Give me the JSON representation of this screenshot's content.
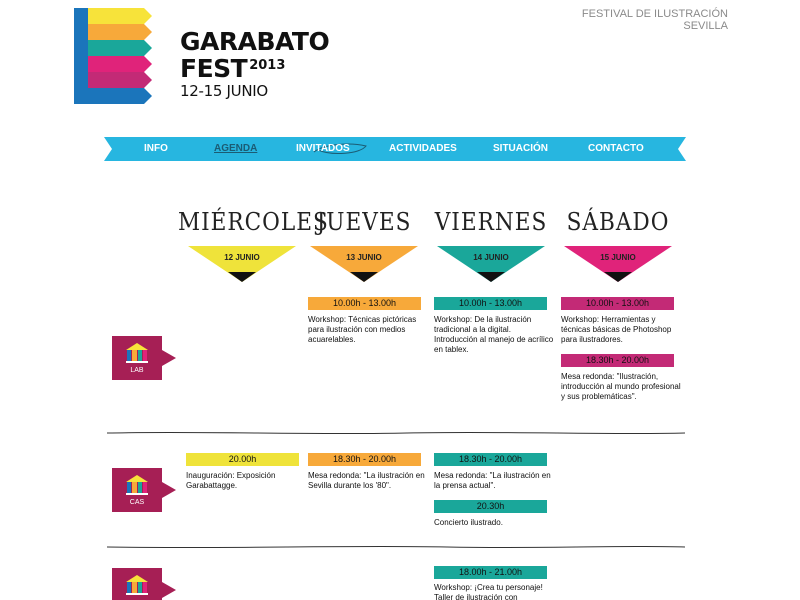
{
  "header": {
    "logo_line1": "GARABATO",
    "logo_line2": "FEST",
    "logo_year": "2013",
    "logo_dates": "12-15 JUNIO",
    "festival_line1": "FESTIVAL DE ILUSTRACIÓN",
    "festival_line2": "SEVILLA",
    "logo_colors": [
      "#f7e33a",
      "#f7a93a",
      "#1aa79a",
      "#e0237a",
      "#c32a76",
      "#1b75bb"
    ]
  },
  "nav": {
    "items": [
      "INFO",
      "AGENDA",
      "INVITADOS",
      "ACTIVIDADES",
      "SITUACIÓN",
      "CONTACTO"
    ],
    "active": "AGENDA",
    "band_color": "#27b6e0"
  },
  "days": [
    {
      "name": "MIÉRCOLES",
      "date": "12 JUNIO",
      "color": "#efe33a"
    },
    {
      "name": "JUEVES",
      "date": "13 JUNIO",
      "color": "#f7a93a"
    },
    {
      "name": "VIERNES",
      "date": "14 JUNIO",
      "color": "#1aa79a"
    },
    {
      "name": "SÁBADO",
      "date": "15 JUNIO",
      "color": "#e0237a"
    }
  ],
  "venues": [
    {
      "label": "LAB",
      "color": "#a61f55"
    },
    {
      "label": "CAS",
      "color": "#a61f55"
    },
    {
      "label": "",
      "color": "#a61f55"
    }
  ],
  "events": {
    "lab": {
      "jueves": {
        "time": "10.00h - 13.00h",
        "desc": "Workshop: Técnicas pictóricas para ilustración con medios acuarelables."
      },
      "viernes": {
        "time": "10.00h - 13.00h",
        "desc": "Workshop: De la ilustración tradicional a la digital. Introducción al manejo de acrílico en tablex."
      },
      "sabado_1": {
        "time": "10.00h - 13.00h",
        "desc": "Workshop: Herramientas y técnicas básicas de Photoshop para ilustradores."
      },
      "sabado_2": {
        "time": "18.30h - 20.00h",
        "desc": "Mesa redonda: \"Ilustración, introducción al mundo profesional y sus problemáticas\"."
      }
    },
    "cas": {
      "miercoles": {
        "time": "20.00h",
        "desc": "Inauguración: Exposición Garabattagge."
      },
      "jueves": {
        "time": "18.30h - 20.00h",
        "desc": "Mesa redonda: \"La ilustración en Sevilla durante los '80\"."
      },
      "viernes_1": {
        "time": "18.30h - 20.00h",
        "desc": "Mesa redonda: \"La ilustración en la prensa actual\"."
      },
      "viernes_2": {
        "time": "20.30h",
        "desc": "Concierto ilustrado."
      }
    },
    "third": {
      "viernes": {
        "time": "18.00h - 21.00h",
        "desc": "Workshop: ¡Crea tu personaje! Taller de ilustración con"
      }
    }
  }
}
